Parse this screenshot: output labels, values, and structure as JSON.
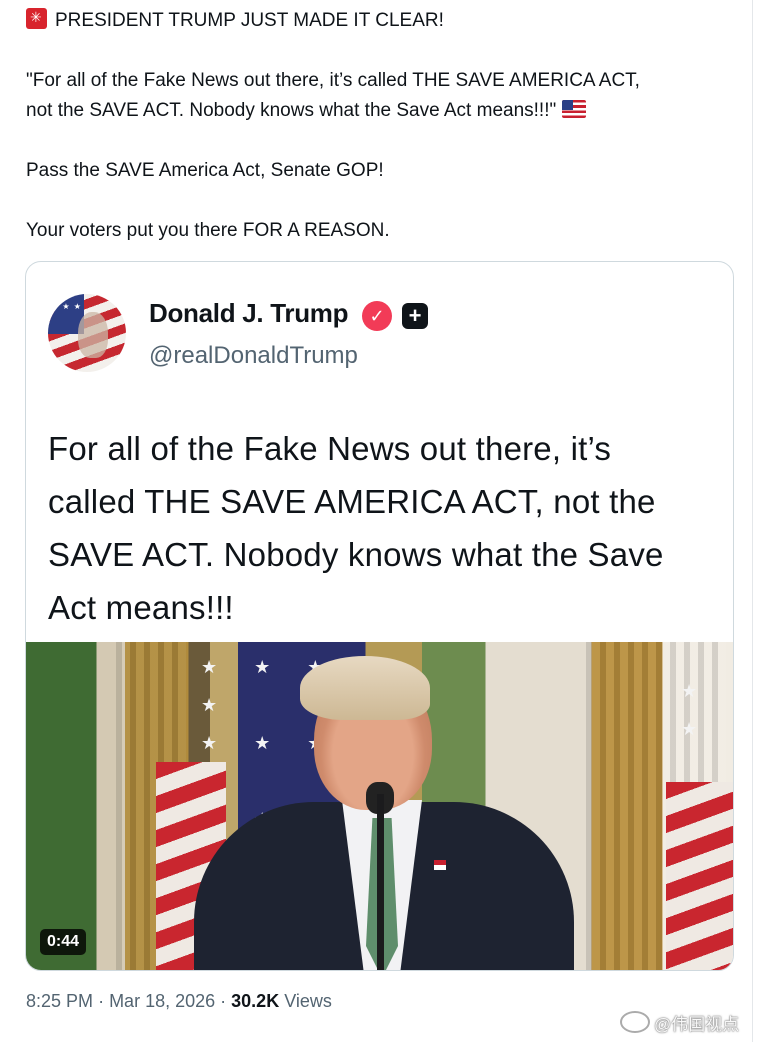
{
  "post": {
    "line1": "PRESIDENT TRUMP JUST MADE IT CLEAR!",
    "quote_line1": "\"For all of the Fake News out there, it’s called THE SAVE AMERICA ACT,",
    "quote_line2": "not the SAVE ACT. Nobody knows what the Save Act means!!!\"",
    "line3": "Pass the SAVE America Act, Senate GOP!",
    "line4": "Your voters put you there FOR A REASON.",
    "emoji_start": "police-light-icon",
    "emoji_end": "us-flag-icon"
  },
  "quoted_post": {
    "author_name": "Donald J. Trump",
    "handle": "@realDonaldTrump",
    "verified_color": "#f23b57",
    "body_lines": [
      "For all of the Fake News out there, it’s",
      "called THE SAVE AMERICA ACT, not the",
      "SAVE ACT. Nobody knows what the Save",
      "Act means!!!"
    ]
  },
  "video": {
    "duration": "0:44"
  },
  "meta": {
    "time": "8:25 PM",
    "date": "Mar 18, 2026",
    "views_count": "30.2K",
    "views_label": "Views"
  },
  "watermark": "@伟国视点"
}
